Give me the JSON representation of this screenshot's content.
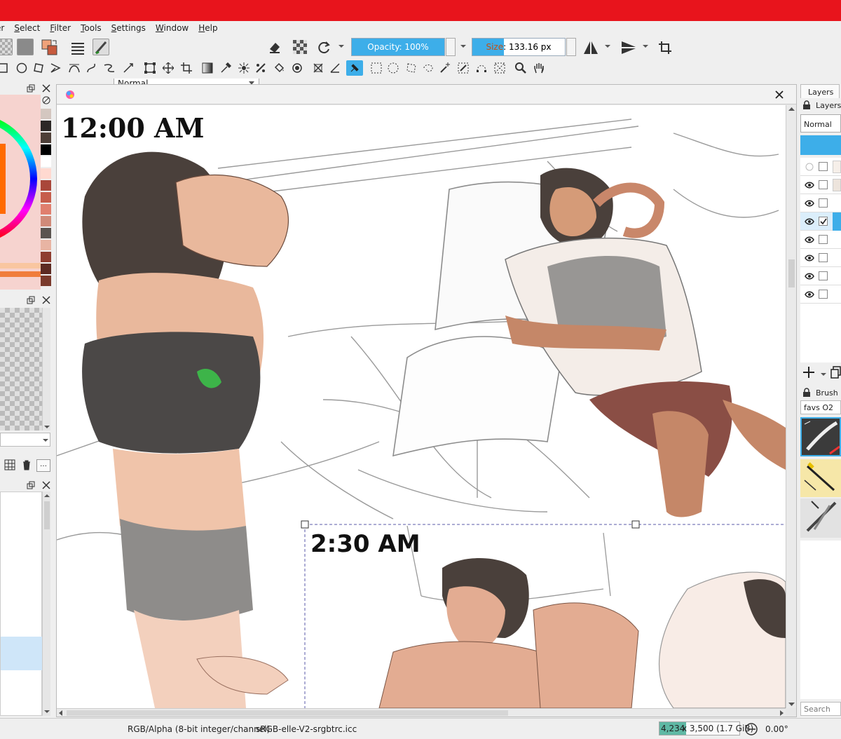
{
  "menu": {
    "items": [
      {
        "label": "er"
      },
      {
        "label": "Select",
        "underline": "S",
        "rest": "elect"
      },
      {
        "label": "Filter",
        "underline": "F",
        "rest": "ilter"
      },
      {
        "label": "Tools",
        "underline": "T",
        "rest": "ools"
      },
      {
        "label": "Settings",
        "underline": "S",
        "rest": "ettings"
      },
      {
        "label": "Window",
        "underline": "W",
        "rest": "indow"
      },
      {
        "label": "Help",
        "underline": "H",
        "rest": "elp"
      }
    ]
  },
  "toolbar": {
    "blend_mode": "Normal",
    "opacity_label": "Opacity: 100%",
    "opacity_fraction": 1.0,
    "size_label": "Size: 133.16 px",
    "size_fraction": 0.34
  },
  "canvas": {
    "panel1_time": "12:00 AM",
    "panel2_time": "2:30 AM"
  },
  "right_dock": {
    "tab_label": "Layers",
    "header_label": "Layers",
    "blend_mode": "Normal",
    "brush_header": "Brush P",
    "brush_tag": "favs O2",
    "search_placeholder": "Search"
  },
  "status": {
    "color_info": "RGB/Alpha (8-bit integer/channel)",
    "profile": "sRGB-elle-V2-srgbtrc.icc",
    "dimensions_highlight": "4,234",
    "dimensions_rest": " x 3,500 (1.7 GiB)",
    "rotation": "0.00°"
  },
  "colors": {
    "titlebar": "#e8141c",
    "accent": "#3daee9",
    "skin": "#e7b59a",
    "hair": "#4a403b",
    "shorts": "#8a4e45"
  }
}
